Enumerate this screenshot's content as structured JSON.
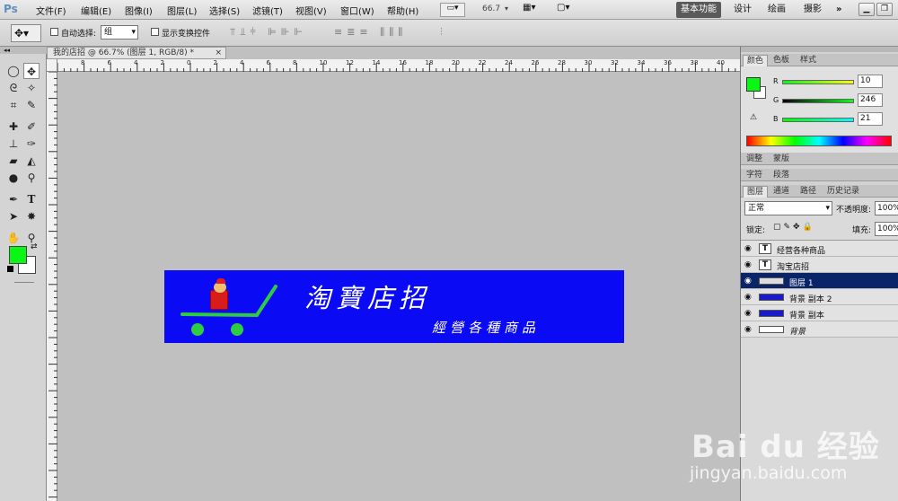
{
  "app": {
    "logo": "Ps",
    "zoom": "66.7",
    "workspace_active": "基本功能",
    "workspaces": [
      "设计",
      "绘画",
      "摄影"
    ],
    "more": "»"
  },
  "menu": [
    "文件(F)",
    "编辑(E)",
    "图像(I)",
    "图层(L)",
    "选择(S)",
    "滤镜(T)",
    "视图(V)",
    "窗口(W)",
    "帮助(H)"
  ],
  "options": {
    "auto_select_label": "自动选择:",
    "auto_select_value": "组",
    "show_transform_label": "显示变换控件"
  },
  "document": {
    "tab_title": "我的店招 @ 66.7% (图层 1, RGB/8) *",
    "close": "×"
  },
  "ruler_h": [
    "8",
    "6",
    "4",
    "2",
    "0",
    "2",
    "4",
    "6",
    "8",
    "10",
    "12",
    "14",
    "16",
    "18",
    "20",
    "22",
    "24",
    "26",
    "28",
    "30",
    "32",
    "34",
    "36",
    "38",
    "40"
  ],
  "banner": {
    "title": "淘寶店招",
    "subtitle": "經營各種商品",
    "bg_color": "#0a0af5",
    "cart_color": "#2ecc40"
  },
  "color_panel": {
    "tabs": [
      "颜色",
      "色板",
      "样式"
    ],
    "fg_color": "#0af615",
    "bg_color": "#ffffff",
    "r": {
      "label": "R",
      "value": "10"
    },
    "g": {
      "label": "G",
      "value": "246"
    },
    "b": {
      "label": "B",
      "value": "21"
    }
  },
  "adjust_tabs": [
    "调整",
    "蒙版"
  ],
  "char_tabs": [
    "字符",
    "段落"
  ],
  "layers_panel": {
    "tabs": [
      "图层",
      "通道",
      "路径",
      "历史记录"
    ],
    "blend_mode": "正常",
    "opacity_label": "不透明度:",
    "opacity_value": "100%",
    "lock_label": "锁定:",
    "fill_label": "填充:",
    "fill_value": "100%",
    "layers": [
      {
        "name": "经营各种商品",
        "type": "text",
        "selected": false
      },
      {
        "name": "淘宝店招",
        "type": "text",
        "selected": false
      },
      {
        "name": "图层 1",
        "type": "image",
        "selected": true
      },
      {
        "name": "背景 副本 2",
        "type": "fill",
        "selected": false
      },
      {
        "name": "背景 副本",
        "type": "fill",
        "selected": false
      },
      {
        "name": "背景",
        "type": "bg",
        "selected": false
      }
    ]
  },
  "watermark": {
    "brand": "Bai du 经验",
    "url": "jingyan.baidu.com"
  }
}
